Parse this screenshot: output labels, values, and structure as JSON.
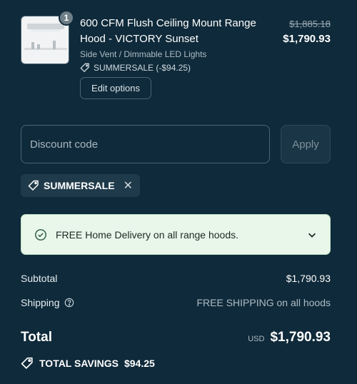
{
  "product": {
    "quantity": "1",
    "name": "600 CFM Flush Ceiling Mount Range Hood - VICTORY Sunset",
    "variant": "Side Vent / Dimmable LED Lights",
    "discount_label": "SUMMERSALE (-$94.25)",
    "edit_label": "Edit options",
    "compare_price": "$1,885.18",
    "price": "$1,790.93",
    "thumbnail_icon": "range-hood-image"
  },
  "discount": {
    "placeholder": "Discount code",
    "apply_label": "Apply",
    "applied_code": "SUMMERSALE"
  },
  "banner": {
    "text": "FREE Home Delivery on all range hoods."
  },
  "summary": {
    "subtotal_label": "Subtotal",
    "subtotal_value": "$1,790.93",
    "shipping_label": "Shipping",
    "shipping_value": "FREE SHIPPING on all hoods",
    "total_label": "Total",
    "currency": "USD",
    "total_value": "$1,790.93",
    "savings_label": "TOTAL SAVINGS",
    "savings_value": "$94.25"
  },
  "colors": {
    "background": "#0f2a3a",
    "banner_bg": "#e8f7ea",
    "chip_bg": "#1f3a4a"
  }
}
